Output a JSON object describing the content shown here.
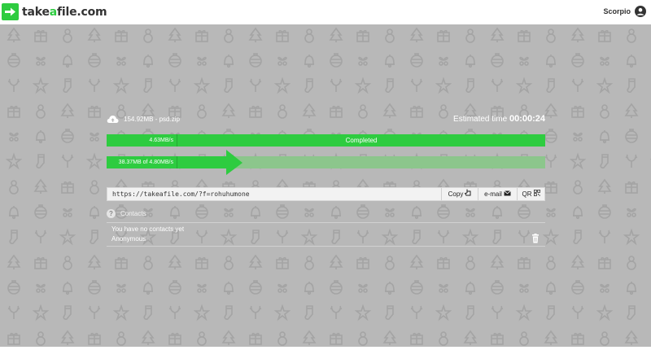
{
  "app": {
    "logo_prefix": "take",
    "logo_accent": "a",
    "logo_suffix": "file.com",
    "brand_color": "#2ecc40"
  },
  "user": {
    "name": "Scorpio",
    "icon": "user-circle-icon"
  },
  "transfer": {
    "file_label": "154.92MB - psd.zip",
    "eta_label": "Estimated time",
    "eta_value": "00:00:24",
    "upload": {
      "speed": "4.63MB/s",
      "status": "Completed"
    },
    "download": {
      "label": "38.37MB of 4.80MB/s",
      "progress": 0.31
    }
  },
  "share": {
    "link": "https://takeafile.com/?f=rohuhumone",
    "copy_label": "Copy",
    "email_label": "e-mail",
    "qr_label": "QR"
  },
  "contacts": {
    "title": "Contacts",
    "empty_message": "You have no contacts yet",
    "entry": "Anonymous"
  },
  "colors": {
    "accent": "#2ecc40",
    "background": "#b8b8b8",
    "progress_track": "#8cc68c"
  }
}
